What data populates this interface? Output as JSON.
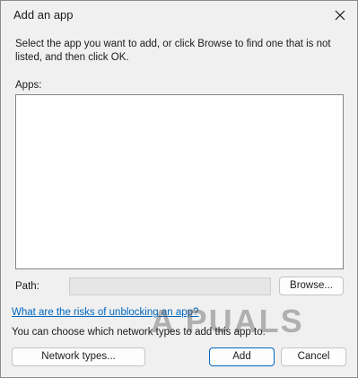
{
  "dialog": {
    "title": "Add an app",
    "instructions": "Select the app you want to add, or click Browse to find one that is not listed, and then click OK.",
    "apps_label": "Apps:",
    "path_label": "Path:",
    "path_value": "",
    "browse_label": "Browse...",
    "risk_link": "What are the risks of unblocking an app?",
    "choose_text": "You can choose which network types to add this app to.",
    "network_types_label": "Network types...",
    "add_label": "Add",
    "cancel_label": "Cancel"
  },
  "watermark": {
    "text": "A PUALS"
  },
  "colors": {
    "link": "#0067c0",
    "accent_border": "#0067c0"
  },
  "icons": {
    "close": "close-icon"
  }
}
